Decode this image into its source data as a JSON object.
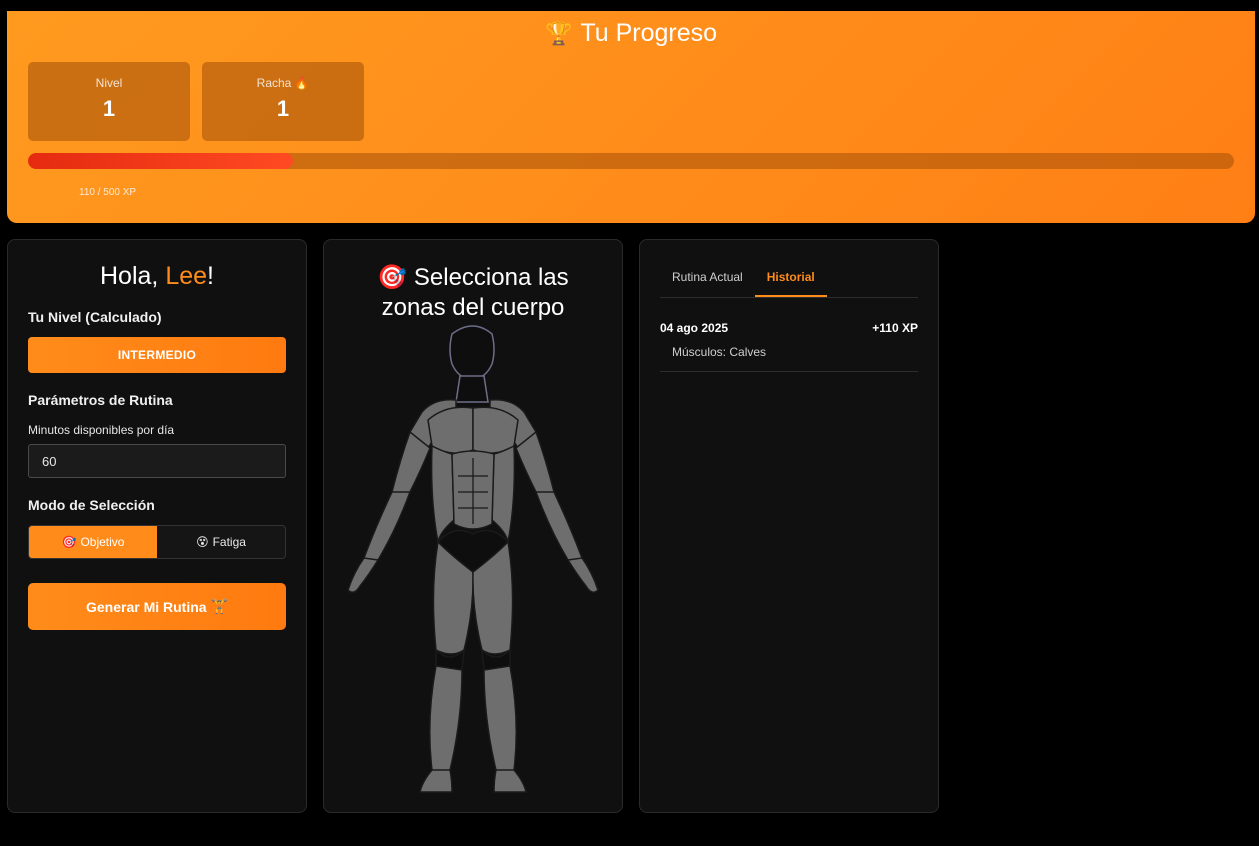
{
  "progress": {
    "trophy_icon": "🏆",
    "title": "Tu Progreso",
    "level_label": "Nivel",
    "level_value": "1",
    "streak_label": "Racha",
    "streak_icon": "🔥",
    "streak_value": "1",
    "xp_text": "110 / 500 XP",
    "xp_fraction": 0.22,
    "accent_color": "#ff8c1a"
  },
  "left_panel": {
    "greeting_prefix": "Hola, ",
    "user_name": "Lee",
    "greeting_suffix": "!",
    "level_section_label": "Tu Nivel (Calculado)",
    "level_button_label": "INTERMEDIO",
    "params_label": "Parámetros de Rutina",
    "minutes_label": "Minutos disponibles por día",
    "minutes_value": "60",
    "mode_label": "Modo de Selección",
    "mode_options": [
      {
        "icon": "🎯",
        "label": "Objetivo",
        "active": true
      },
      {
        "icon": "😵",
        "label": "Fatiga",
        "active": false
      }
    ],
    "generate_label": "Generar Mi Rutina",
    "generate_icon": "🏋"
  },
  "middle_panel": {
    "title_icon": "🎯",
    "title_line1": "Selecciona las",
    "title_line2": "zonas del cuerpo"
  },
  "right_panel": {
    "tabs": [
      {
        "label": "Rutina Actual",
        "active": false
      },
      {
        "label": "Historial",
        "active": true
      }
    ],
    "history": [
      {
        "date": "04 ago 2025",
        "xp": "+110 XP",
        "muscles": "Músculos: Calves"
      }
    ]
  }
}
